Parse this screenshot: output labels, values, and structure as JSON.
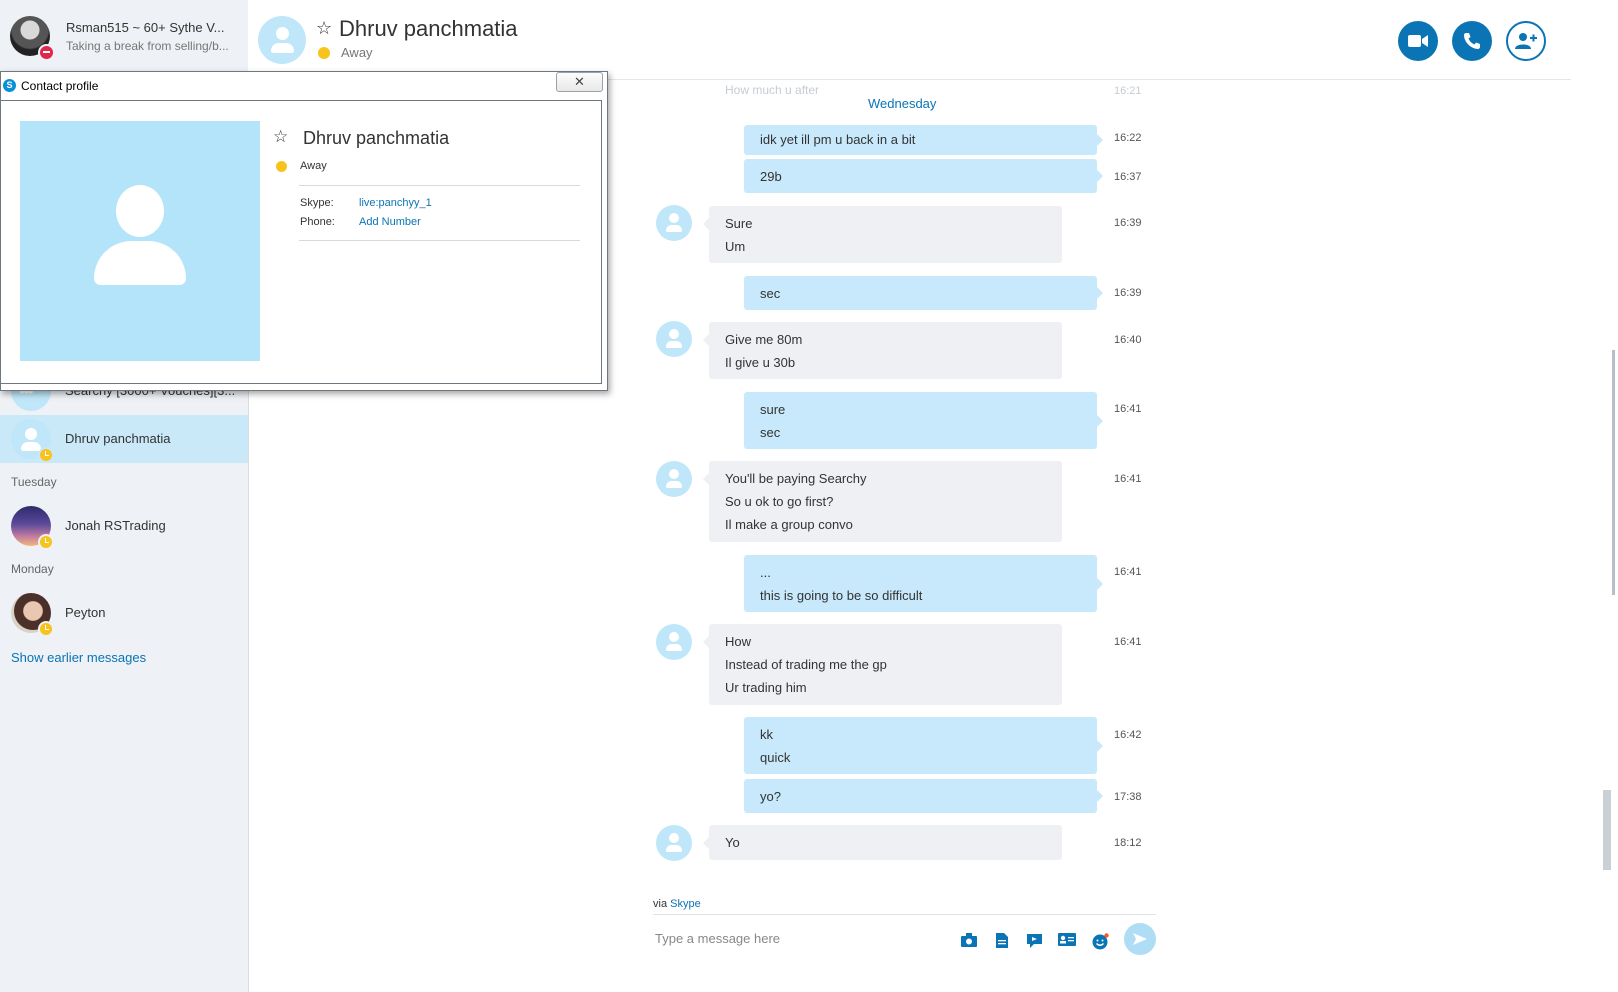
{
  "me": {
    "name": "Rsman515 ~ 60+ Sythe V...",
    "mood": "Taking a break from selling/b..."
  },
  "sidebar": {
    "conversations": [
      {
        "name": "Searchy [3000+ Vouches][3...",
        "avatar": "group-icon"
      },
      {
        "name": "Dhruv panchmatia",
        "avatar": "person-icon",
        "active": true,
        "status": "away"
      }
    ],
    "groups": [
      {
        "day": "Tuesday",
        "items": [
          {
            "name": "Jonah RSTrading",
            "status": "away"
          }
        ]
      },
      {
        "day": "Monday",
        "items": [
          {
            "name": "Peyton",
            "status": "away"
          }
        ]
      }
    ],
    "show_earlier": "Show earlier messages"
  },
  "header": {
    "contact_name": "Dhruv panchmatia",
    "status": "Away",
    "buttons": [
      "video-call-icon",
      "call-icon",
      "add-contact-icon"
    ]
  },
  "chat": {
    "faded_message": "How much u after",
    "faded_time": "16:21",
    "day_separator": "Wednesday",
    "messages": [
      {
        "dir": "out",
        "lines": [
          "idk yet ill pm u back in a bit"
        ],
        "time": "16:22"
      },
      {
        "dir": "out",
        "lines": [
          "29b"
        ],
        "time": "16:37"
      },
      {
        "dir": "in",
        "lines": [
          "Sure",
          "Um"
        ],
        "time": "16:39"
      },
      {
        "dir": "out",
        "lines": [
          "sec"
        ],
        "time": "16:39"
      },
      {
        "dir": "in",
        "lines": [
          "Give me 80m",
          "Il give u 30b"
        ],
        "time": "16:40"
      },
      {
        "dir": "out",
        "lines": [
          "sure",
          "sec"
        ],
        "time": "16:41"
      },
      {
        "dir": "in",
        "lines": [
          "You'll be paying Searchy",
          "So u ok to go first?",
          "Il make a group convo"
        ],
        "time": "16:41"
      },
      {
        "dir": "out",
        "lines": [
          "...",
          "this is going to be so difficult"
        ],
        "time": "16:41"
      },
      {
        "dir": "in",
        "lines": [
          "How",
          "Instead of trading me the gp",
          "Ur trading him"
        ],
        "time": "16:41"
      },
      {
        "dir": "out",
        "lines": [
          "kk",
          "quick"
        ],
        "time": "16:42"
      },
      {
        "dir": "out",
        "lines": [
          "yo?"
        ],
        "time": "17:38"
      },
      {
        "dir": "in",
        "lines": [
          "Yo"
        ],
        "time": "18:12"
      }
    ],
    "via_prefix": "via",
    "via_link": "Skype",
    "compose_placeholder": "Type a message here",
    "tools": [
      "send-photo-icon",
      "send-file-icon",
      "video-message-icon",
      "send-contact-icon",
      "emoticon-icon",
      "send-icon"
    ]
  },
  "popup": {
    "title": "Contact profile",
    "name": "Dhruv panchmatia",
    "status": "Away",
    "skype_label": "Skype:",
    "skype_value": "live:panchyy_1",
    "phone_label": "Phone:",
    "phone_value": "Add Number"
  },
  "colors": {
    "accent": "#0a74b5",
    "outgoing_bubble": "#c7e9fb",
    "incoming_bubble": "#eef0f3",
    "away": "#f8c31c",
    "sidebar_bg": "#eef1f5",
    "active_row": "#c9e9f9"
  }
}
